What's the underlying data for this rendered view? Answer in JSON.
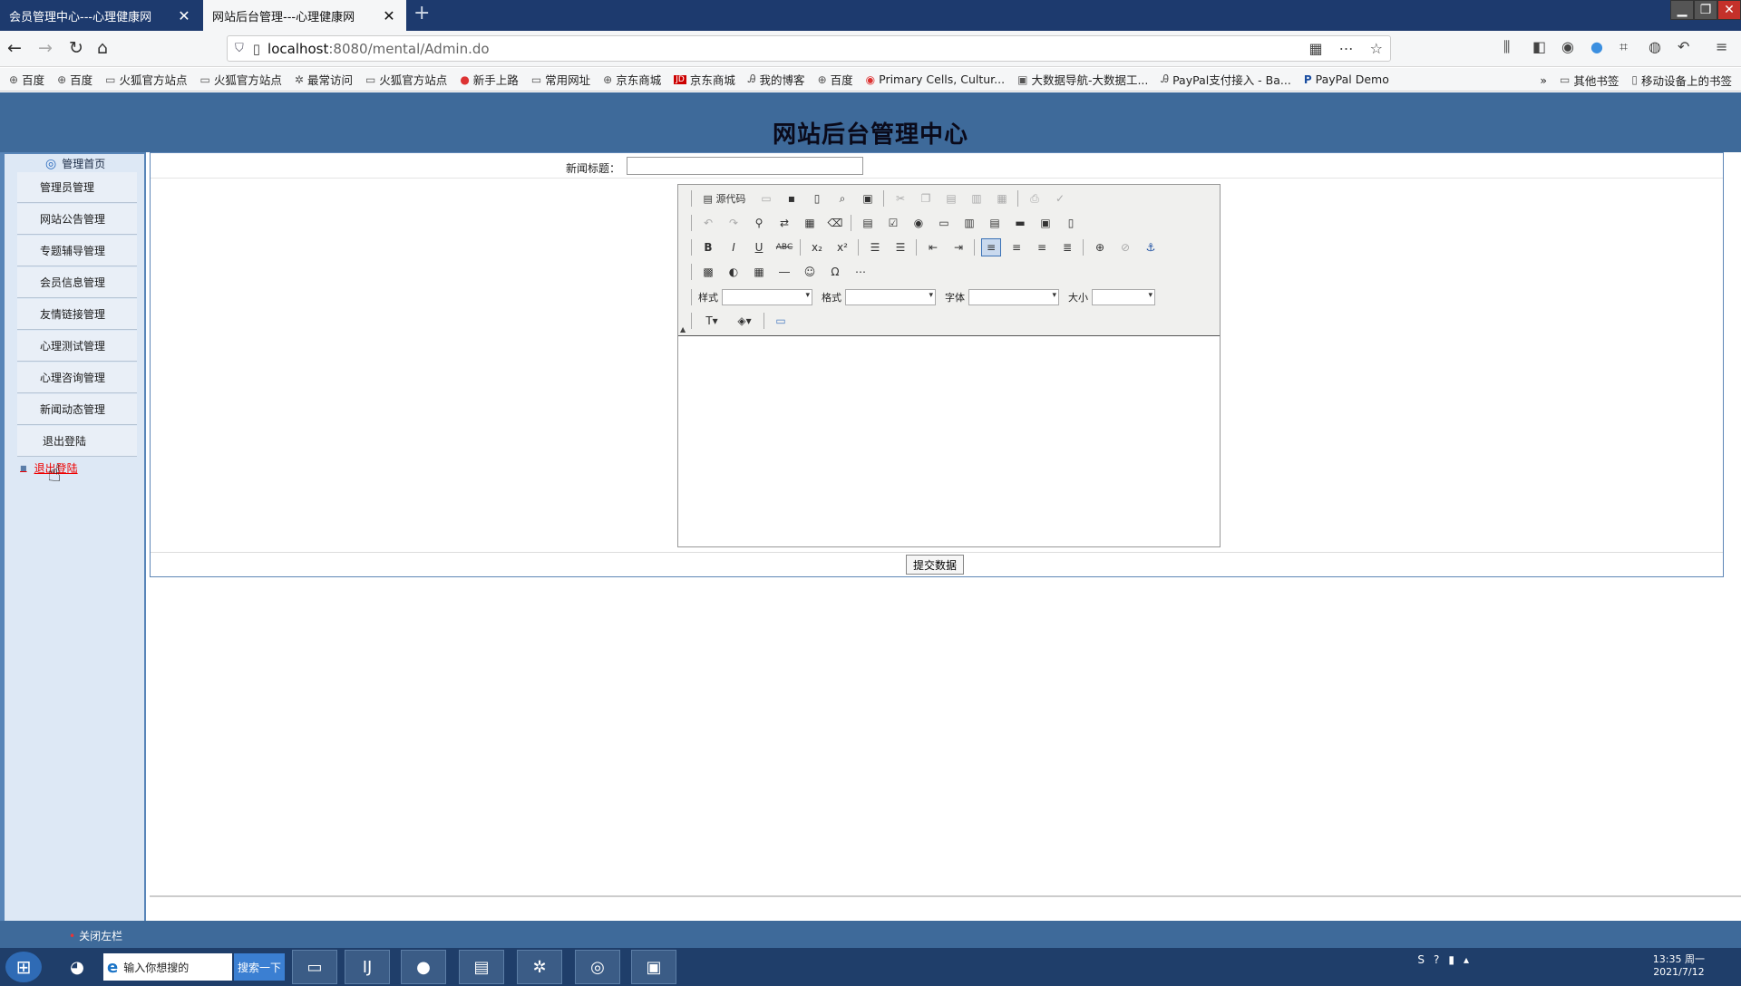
{
  "browser": {
    "tabs": [
      {
        "label": "会员管理中心---心理健康网",
        "close": "✕"
      },
      {
        "label": "网站后台管理---心理健康网",
        "close": "✕"
      }
    ],
    "new_tab": "+",
    "url_host": "localhost",
    "url_path": ":8080/mental/Admin.do",
    "bookmarks": [
      {
        "icon": "globe-icon",
        "label": "百度"
      },
      {
        "icon": "globe-icon",
        "label": "百度"
      },
      {
        "icon": "folder-icon",
        "label": "火狐官方站点"
      },
      {
        "icon": "folder-icon",
        "label": "火狐官方站点"
      },
      {
        "icon": "gear-icon",
        "label": "最常访问"
      },
      {
        "icon": "folder-icon",
        "label": "火狐官方站点"
      },
      {
        "icon": "firefox-icon",
        "label": "新手上路"
      },
      {
        "icon": "folder-icon",
        "label": "常用网址"
      },
      {
        "icon": "globe-icon",
        "label": "京东商城"
      },
      {
        "icon": "jd-icon",
        "label": "京东商城"
      },
      {
        "icon": "blog-icon",
        "label": "我的博客"
      },
      {
        "icon": "globe-icon",
        "label": "百度"
      },
      {
        "icon": "target-icon",
        "label": "Primary Cells, Cultur..."
      },
      {
        "icon": "nav-icon",
        "label": "大数据导航-大数据工..."
      },
      {
        "icon": "blog-icon",
        "label": "PayPal支付接入 - Ba..."
      },
      {
        "icon": "paypal-icon",
        "label": "PayPal Demo"
      }
    ],
    "bookmarks_right": [
      {
        "label": "其他书签"
      },
      {
        "label": "移动设备上的书签"
      }
    ]
  },
  "page": {
    "title": "网站后台管理中心",
    "sidebar": {
      "heading": "管理首页",
      "items": [
        {
          "label": "管理员管理"
        },
        {
          "label": "网站公告管理"
        },
        {
          "label": "专题辅导管理"
        },
        {
          "label": "会员信息管理"
        },
        {
          "label": "友情链接管理"
        },
        {
          "label": "心理测试管理"
        },
        {
          "label": "心理咨询管理"
        },
        {
          "label": "新闻动态管理"
        },
        {
          "label": "退出登陆"
        }
      ],
      "link": "退出登陆"
    },
    "form": {
      "title_label": "新闻标题：",
      "title_value": "",
      "editor": {
        "source_label": "源代码",
        "style_label": "样式",
        "format_label": "格式",
        "font_label": "字体",
        "size_label": "大小"
      },
      "submit_label": "提交数据"
    },
    "footer": {
      "close_sidebar": "关闭左栏"
    }
  },
  "taskbar": {
    "search_placeholder": "输入你想搜的",
    "search_button": "搜索一下",
    "time": "13:35 周一",
    "date": "2021/7/12"
  }
}
